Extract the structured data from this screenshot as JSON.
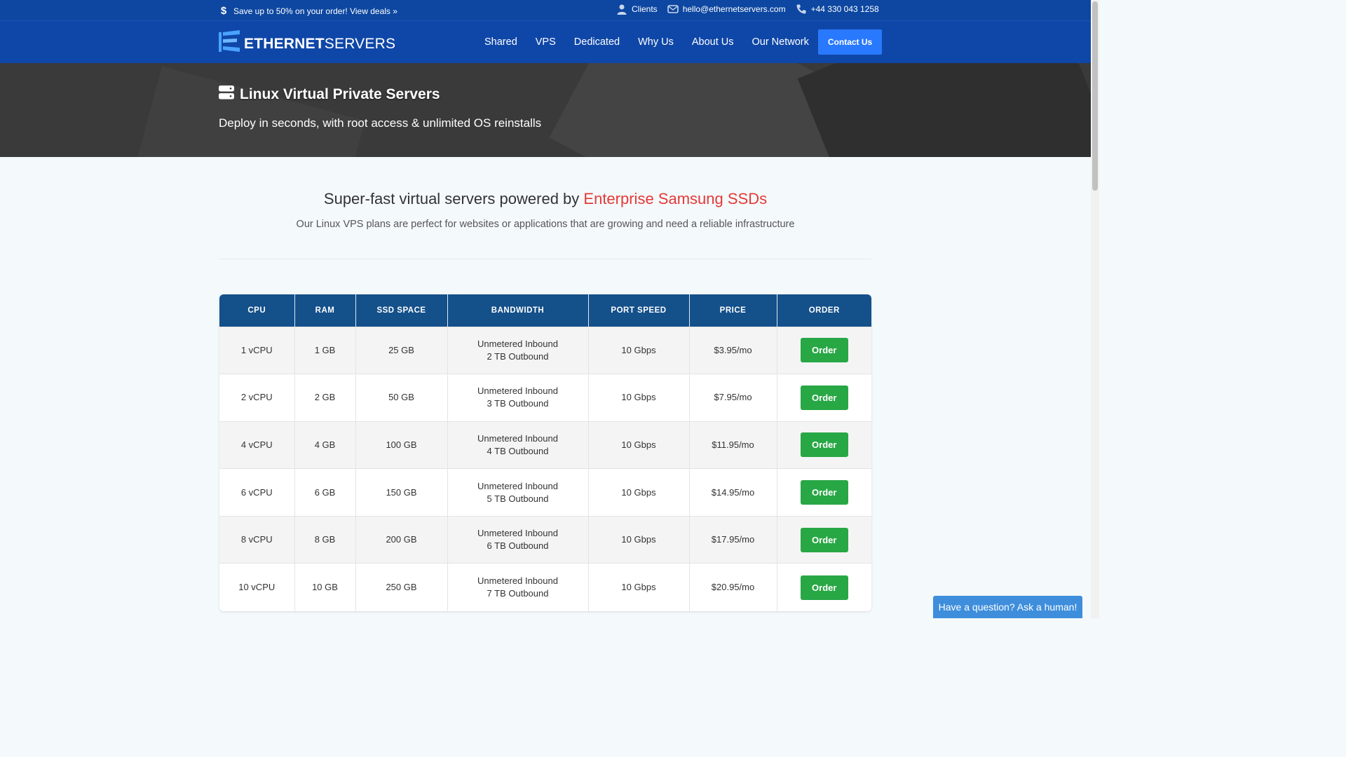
{
  "topbar": {
    "promo": "Save up to 50% on your order! View deals »",
    "clients": "Clients",
    "email": "hello@ethernetservers.com",
    "phone": "+44 330 043 1258"
  },
  "nav": {
    "logo_bold": "ETHERNET",
    "logo_light": "SERVERS",
    "items": [
      "Shared",
      "VPS",
      "Dedicated",
      "Why Us",
      "About Us",
      "Our Network"
    ],
    "contact": "Contact Us"
  },
  "hero": {
    "title": "Linux Virtual Private Servers",
    "subtitle": "Deploy in seconds, with root access & unlimited OS reinstalls"
  },
  "intro": {
    "title_prefix": "Super-fast virtual servers powered by ",
    "title_highlight": "Enterprise Samsung SSDs",
    "subtitle": "Our Linux VPS plans are perfect for websites or applications that are growing and need a reliable infrastructure"
  },
  "table": {
    "headers": [
      "CPU",
      "RAM",
      "SSD SPACE",
      "BANDWIDTH",
      "PORT SPEED",
      "PRICE",
      "ORDER"
    ],
    "order_label": "Order",
    "rows": [
      {
        "cpu": "1 vCPU",
        "ram": "1 GB",
        "ssd": "25 GB",
        "bw_in": "Unmetered Inbound",
        "bw_out": "2 TB Outbound",
        "port": "10 Gbps",
        "price": "$3.95/mo"
      },
      {
        "cpu": "2 vCPU",
        "ram": "2 GB",
        "ssd": "50 GB",
        "bw_in": "Unmetered Inbound",
        "bw_out": "3 TB Outbound",
        "port": "10 Gbps",
        "price": "$7.95/mo"
      },
      {
        "cpu": "4 vCPU",
        "ram": "4 GB",
        "ssd": "100 GB",
        "bw_in": "Unmetered Inbound",
        "bw_out": "4 TB Outbound",
        "port": "10 Gbps",
        "price": "$11.95/mo"
      },
      {
        "cpu": "6 vCPU",
        "ram": "6 GB",
        "ssd": "150 GB",
        "bw_in": "Unmetered Inbound",
        "bw_out": "5 TB Outbound",
        "port": "10 Gbps",
        "price": "$14.95/mo"
      },
      {
        "cpu": "8 vCPU",
        "ram": "8 GB",
        "ssd": "200 GB",
        "bw_in": "Unmetered Inbound",
        "bw_out": "6 TB Outbound",
        "port": "10 Gbps",
        "price": "$17.95/mo"
      },
      {
        "cpu": "10 vCPU",
        "ram": "10 GB",
        "ssd": "250 GB",
        "bw_in": "Unmetered Inbound",
        "bw_out": "7 TB Outbound",
        "port": "10 Gbps",
        "price": "$20.95/mo"
      }
    ]
  },
  "chat": {
    "label": "Have a question? Ask a human!"
  },
  "colors": {
    "topbar": "#0d47a1",
    "nav": "#0f47a8",
    "contact_button": "#2979ff",
    "table_header": "#14508a",
    "order_button": "#28a745",
    "highlight": "#e53935",
    "chat": "#3e8edc"
  }
}
